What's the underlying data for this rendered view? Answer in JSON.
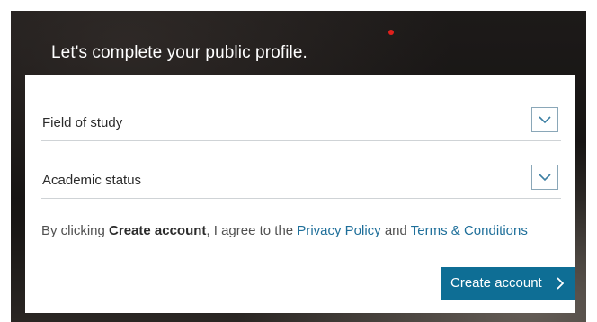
{
  "header": {
    "title": "Let's complete your public profile."
  },
  "form": {
    "fields": [
      {
        "label": "Field of study",
        "icon": "chevron-down-icon"
      },
      {
        "label": "Academic status",
        "icon": "chevron-down-icon"
      }
    ],
    "agreement": {
      "prefix": "By clicking",
      "button_ref": "Create account",
      "middle": ", I agree to the",
      "privacy_link": "Privacy Policy",
      "and": "and",
      "terms_link": "Terms & Conditions"
    },
    "submit_label": "Create account",
    "submit_icon": "chevron-right-icon"
  },
  "colors": {
    "accent": "#0e6e95",
    "link": "#1f6f9a",
    "indicator": "#e0201c"
  }
}
